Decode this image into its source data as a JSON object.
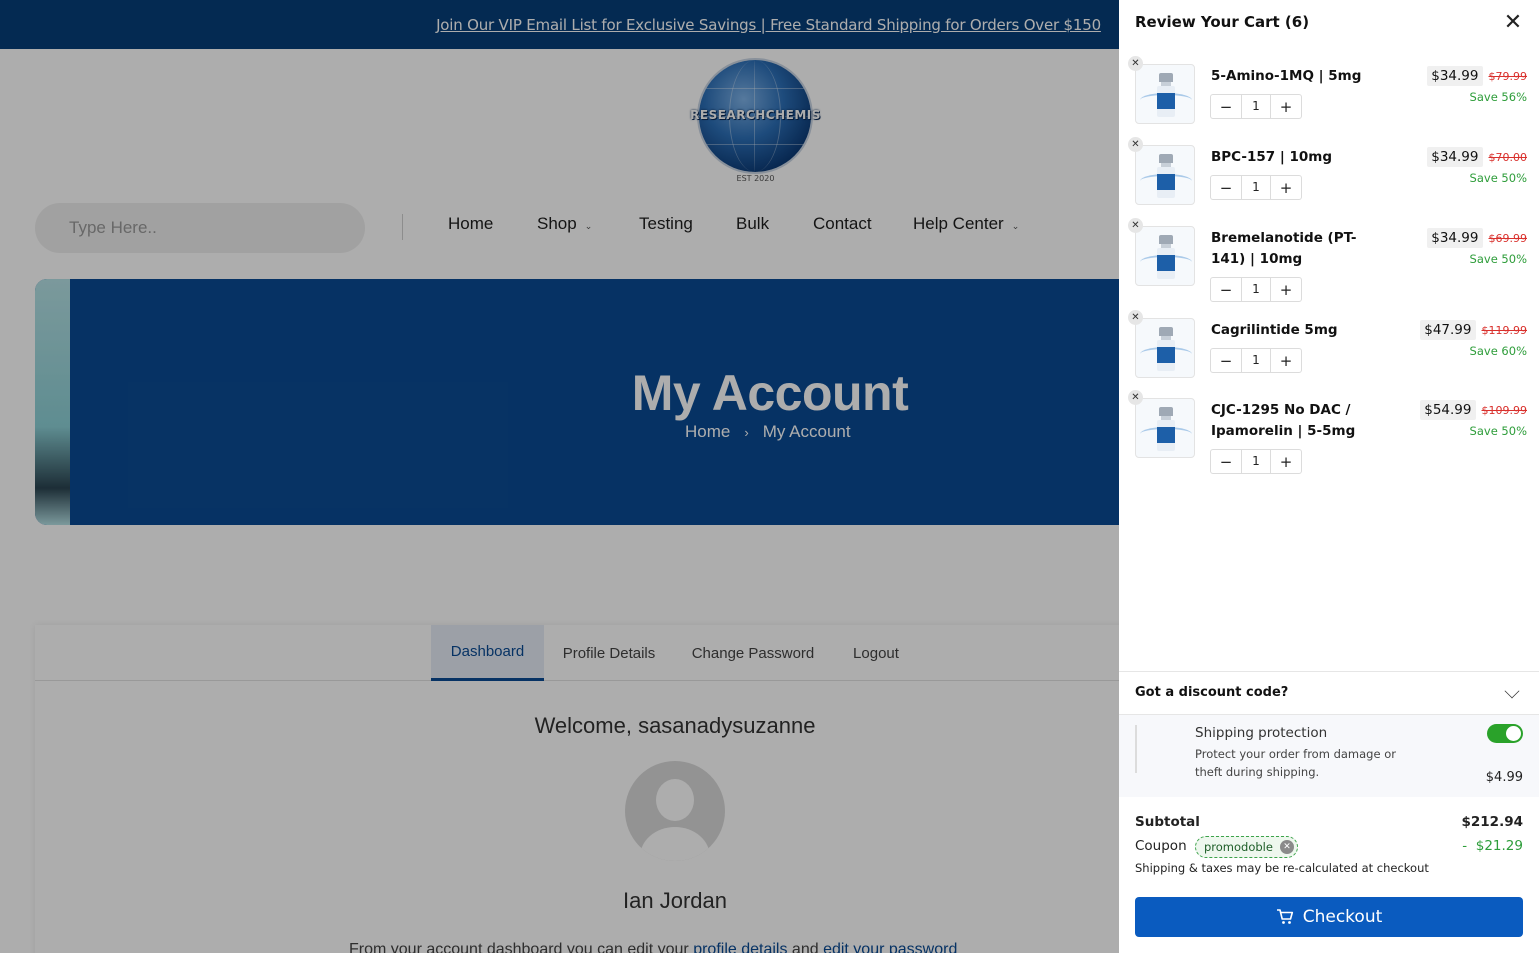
{
  "announcement": {
    "text": "Join Our VIP Email List for Exclusive Savings | Free Standard Shipping for Orders Over $150"
  },
  "logo": {
    "text": "RESEARCHCHEMIS",
    "sub": "EST 2020"
  },
  "search": {
    "placeholder": "Type Here.."
  },
  "nav": {
    "items": [
      {
        "label": "Home",
        "has_dropdown": false
      },
      {
        "label": "Shop",
        "has_dropdown": true
      },
      {
        "label": "Testing",
        "has_dropdown": false
      },
      {
        "label": "Bulk",
        "has_dropdown": false
      },
      {
        "label": "Contact",
        "has_dropdown": false
      },
      {
        "label": "Help Center",
        "has_dropdown": true
      }
    ]
  },
  "hero": {
    "title": "My Account",
    "breadcrumb": {
      "home": "Home",
      "separator": "›",
      "current": "My Account"
    }
  },
  "account": {
    "tabs": [
      {
        "label": "Dashboard",
        "active": true
      },
      {
        "label": "Profile Details",
        "active": false
      },
      {
        "label": "Change Password",
        "active": false
      },
      {
        "label": "Logout",
        "active": false
      }
    ],
    "welcome": "Welcome, sasanadysuzanne",
    "user_name": "Ian Jordan",
    "dashboard_text_start": "From your account dashboard you can edit your ",
    "link_profile": "profile details",
    "text_and": " and ",
    "link_password": "edit your password"
  },
  "cart": {
    "title": "Review Your Cart (6)",
    "items": [
      {
        "name": "5-Amino-1MQ | 5mg",
        "qty": "1",
        "price": "$34.99",
        "was": "$79.99",
        "save": "Save 56%"
      },
      {
        "name": "BPC-157 | 10mg",
        "qty": "1",
        "price": "$34.99",
        "was": "$70.00",
        "save": "Save 50%"
      },
      {
        "name": "Bremelanotide (PT-141) | 10mg",
        "qty": "1",
        "price": "$34.99",
        "was": "$69.99",
        "save": "Save 50%"
      },
      {
        "name": "Cagrilintide 5mg",
        "qty": "1",
        "price": "$47.99",
        "was": "$119.99",
        "save": "Save 60%"
      },
      {
        "name": "CJC-1295 No DAC / Ipamorelin | 5-5mg",
        "qty": "1",
        "price": "$54.99",
        "was": "$109.99",
        "save": "Save 50%"
      }
    ],
    "discount_label": "Got a discount code?",
    "shipping_protection": {
      "title": "Shipping protection",
      "description": "Protect your order from damage or theft during shipping.",
      "price": "$4.99",
      "enabled": true
    },
    "subtotal_label": "Subtotal",
    "subtotal": "$212.94",
    "coupon_label": "Coupon",
    "coupon_code": "promodoble",
    "coupon_discount": "-  $21.29",
    "note": "Shipping & taxes may be re-calculated at checkout",
    "checkout_label": "Checkout"
  },
  "colors": {
    "brand_blue": "#0a4b94",
    "topbar_blue": "#073f7a",
    "checkout_blue": "#0a5bbf",
    "sale_red": "#d9302c",
    "save_green": "#2e9d3a",
    "toggle_green": "#2aa22a"
  },
  "icons": {
    "close": "close-icon",
    "remove": "remove-item-icon",
    "minus": "minus-icon",
    "plus": "plus-icon",
    "chevron": "chevron-down-icon",
    "cart": "cart-icon"
  }
}
